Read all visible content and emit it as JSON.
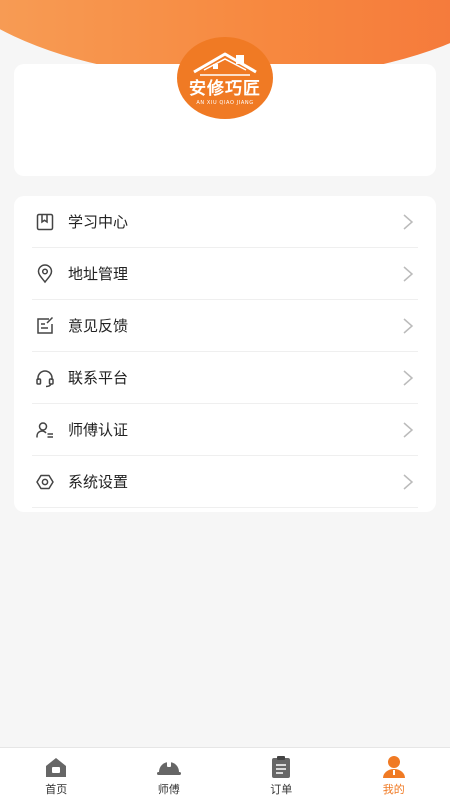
{
  "profile": {
    "logo_title": "安修巧匠",
    "logo_subtitle": "AN XIU QIAO JIANG"
  },
  "menu": [
    {
      "label": "学习中心",
      "icon": "book-icon"
    },
    {
      "label": "地址管理",
      "icon": "location-pin-icon"
    },
    {
      "label": "意见反馈",
      "icon": "feedback-edit-icon"
    },
    {
      "label": "联系平台",
      "icon": "headset-icon"
    },
    {
      "label": "师傅认证",
      "icon": "user-verify-icon"
    },
    {
      "label": "系统设置",
      "icon": "settings-icon"
    }
  ],
  "tabbar": [
    {
      "label": "首页",
      "icon": "home-icon",
      "active": false
    },
    {
      "label": "师傅",
      "icon": "helmet-icon",
      "active": false
    },
    {
      "label": "订单",
      "icon": "clipboard-icon",
      "active": false
    },
    {
      "label": "我的",
      "icon": "profile-icon",
      "active": true
    }
  ],
  "colors": {
    "accent": "#f07a24",
    "header_gradient_start": "#f7a15a",
    "header_gradient_end": "#f4733a",
    "icon_gray": "#444444",
    "chevron": "#bbbbbb"
  }
}
